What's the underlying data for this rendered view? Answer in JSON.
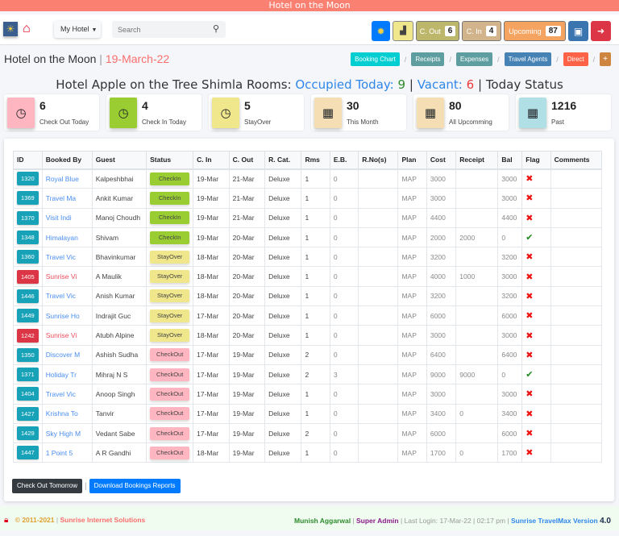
{
  "topbar": {
    "title": "Hotel on the Moon"
  },
  "navbar": {
    "logo_icon": "sun-logo-icon",
    "home_icon": "home-icon",
    "hotel_dropdown": "My Hotel",
    "search": {
      "placeholder": "Search",
      "value": ""
    },
    "buttons": {
      "settings_icon": "gear-icon",
      "chart_icon": "chart-icon",
      "checkout_label": "C. Out",
      "checkout_count": "6",
      "checkin_label": "C. In",
      "checkin_count": "4",
      "upcoming_label": "Upcoming",
      "upcoming_count": "87",
      "bus_icon": "bus-icon",
      "logout_icon": "sign-out-icon"
    }
  },
  "subheader": {
    "hotel_name": "Hotel on the Moon",
    "separator": "|",
    "date": "19-March-22",
    "breadcrumbs": [
      "Booking Chart",
      "Receipts",
      "Expenses",
      "Travel Agents",
      "Direct"
    ],
    "plus_icon": "plus-square-icon"
  },
  "status_line": {
    "prefix": "Hotel Apple on the Tree Shimla Rooms:",
    "occupied_label": "Occupied Today:",
    "occupied": "9",
    "vacant_label": "Vacant:",
    "vacant": "6",
    "suffix": "Today Status"
  },
  "cards": [
    {
      "value": "6",
      "label": "Check Out Today",
      "icon": "clock-icon",
      "color": "#ffb6c1"
    },
    {
      "value": "4",
      "label": "Check In Today",
      "icon": "clock-icon",
      "color": "#9acd32"
    },
    {
      "value": "5",
      "label": "StayOver",
      "icon": "clock-icon",
      "color": "#f0e68c"
    },
    {
      "value": "30",
      "label": "This Month",
      "icon": "calendar-icon",
      "color": "#f5deb3"
    },
    {
      "value": "80",
      "label": "All Upcomming",
      "icon": "calendar-icon",
      "color": "#f5deb3"
    },
    {
      "value": "1216",
      "label": "Past",
      "icon": "calendar-icon",
      "color": "#b0e0e6"
    }
  ],
  "table": {
    "headers": [
      "ID",
      "Booked By",
      "Guest",
      "Status",
      "C. In",
      "C. Out",
      "R. Cat.",
      "Rms",
      "E.B.",
      "R.No(s)",
      "Plan",
      "Cost",
      "Receipt",
      "Bal",
      "Flag",
      "Comments"
    ],
    "rows": [
      {
        "id": "1320",
        "id_color": "#17a2b8",
        "booked_by": "Royal Blue",
        "booked_red": false,
        "guest": "Kalpeshbhai",
        "status": "CheckIn",
        "cin": "19-Mar",
        "cout": "21-Mar",
        "cat": "Deluxe",
        "rms": "1",
        "eb": "0",
        "rno": "",
        "plan": "MAP",
        "cost": "3000",
        "receipt": "",
        "bal": "3000",
        "flag": "x",
        "comments": ""
      },
      {
        "id": "1369",
        "id_color": "#17a2b8",
        "booked_by": "Travel Ma",
        "booked_red": false,
        "guest": "Ankit Kumar",
        "status": "CheckIn",
        "cin": "19-Mar",
        "cout": "21-Mar",
        "cat": "Deluxe",
        "rms": "1",
        "eb": "0",
        "rno": "",
        "plan": "MAP",
        "cost": "3000",
        "receipt": "",
        "bal": "3000",
        "flag": "x",
        "comments": ""
      },
      {
        "id": "1370",
        "id_color": "#17a2b8",
        "booked_by": "Visit Indi",
        "booked_red": false,
        "guest": "Manoj Choudh",
        "status": "CheckIn",
        "cin": "19-Mar",
        "cout": "21-Mar",
        "cat": "Deluxe",
        "rms": "1",
        "eb": "0",
        "rno": "",
        "plan": "MAP",
        "cost": "4400",
        "receipt": "",
        "bal": "4400",
        "flag": "x",
        "comments": ""
      },
      {
        "id": "1348",
        "id_color": "#17a2b8",
        "booked_by": "Himalayan",
        "booked_red": false,
        "guest": "Shivam",
        "status": "CheckIn",
        "cin": "19-Mar",
        "cout": "20-Mar",
        "cat": "Deluxe",
        "rms": "1",
        "eb": "0",
        "rno": "",
        "plan": "MAP",
        "cost": "2000",
        "receipt": "2000",
        "bal": "0",
        "flag": "ok",
        "comments": ""
      },
      {
        "id": "1360",
        "id_color": "#17a2b8",
        "booked_by": "Travel Vic",
        "booked_red": false,
        "guest": "Bhavinkumar",
        "status": "StayOver",
        "cin": "18-Mar",
        "cout": "20-Mar",
        "cat": "Deluxe",
        "rms": "1",
        "eb": "0",
        "rno": "",
        "plan": "MAP",
        "cost": "3200",
        "receipt": "",
        "bal": "3200",
        "flag": "x",
        "comments": ""
      },
      {
        "id": "1405",
        "id_color": "#dc3545",
        "booked_by": "Sunrise Vi",
        "booked_red": true,
        "guest": "A Maulik",
        "status": "StayOver",
        "cin": "18-Mar",
        "cout": "20-Mar",
        "cat": "Deluxe",
        "rms": "1",
        "eb": "0",
        "rno": "",
        "plan": "MAP",
        "cost": "4000",
        "receipt": "1000",
        "bal": "3000",
        "flag": "x",
        "comments": ""
      },
      {
        "id": "1446",
        "id_color": "#17a2b8",
        "booked_by": "Travel Vic",
        "booked_red": false,
        "guest": "Anish Kumar",
        "status": "StayOver",
        "cin": "18-Mar",
        "cout": "20-Mar",
        "cat": "Deluxe",
        "rms": "1",
        "eb": "0",
        "rno": "",
        "plan": "MAP",
        "cost": "3200",
        "receipt": "",
        "bal": "3200",
        "flag": "x",
        "comments": ""
      },
      {
        "id": "1449",
        "id_color": "#17a2b8",
        "booked_by": "Sunrise Ho",
        "booked_red": false,
        "guest": "Indrajit Guc",
        "status": "StayOver",
        "cin": "17-Mar",
        "cout": "20-Mar",
        "cat": "Deluxe",
        "rms": "1",
        "eb": "0",
        "rno": "",
        "plan": "MAP",
        "cost": "6000",
        "receipt": "",
        "bal": "6000",
        "flag": "x",
        "comments": ""
      },
      {
        "id": "1242",
        "id_color": "#dc3545",
        "booked_by": "Sunrise Vi",
        "booked_red": true,
        "guest": "Atubh Alpine",
        "status": "StayOver",
        "cin": "18-Mar",
        "cout": "20-Mar",
        "cat": "Deluxe",
        "rms": "1",
        "eb": "0",
        "rno": "",
        "plan": "MAP",
        "cost": "3000",
        "receipt": "",
        "bal": "3000",
        "flag": "x",
        "comments": ""
      },
      {
        "id": "1350",
        "id_color": "#17a2b8",
        "booked_by": "Discover M",
        "booked_red": false,
        "guest": "Ashish Sudha",
        "status": "CheckOut",
        "cin": "17-Mar",
        "cout": "19-Mar",
        "cat": "Deluxe",
        "rms": "2",
        "eb": "0",
        "rno": "",
        "plan": "MAP",
        "cost": "6400",
        "receipt": "",
        "bal": "6400",
        "flag": "x",
        "comments": ""
      },
      {
        "id": "1371",
        "id_color": "#17a2b8",
        "booked_by": "Holiday Tr",
        "booked_red": false,
        "guest": "Mihraj N S",
        "status": "CheckOut",
        "cin": "17-Mar",
        "cout": "19-Mar",
        "cat": "Deluxe",
        "rms": "2",
        "eb": "3",
        "rno": "",
        "plan": "MAP",
        "cost": "9000",
        "receipt": "9000",
        "bal": "0",
        "flag": "ok",
        "comments": ""
      },
      {
        "id": "1404",
        "id_color": "#17a2b8",
        "booked_by": "Travel Vic",
        "booked_red": false,
        "guest": "Anoop Singh",
        "status": "CheckOut",
        "cin": "17-Mar",
        "cout": "19-Mar",
        "cat": "Deluxe",
        "rms": "1",
        "eb": "0",
        "rno": "",
        "plan": "MAP",
        "cost": "3000",
        "receipt": "",
        "bal": "3000",
        "flag": "x",
        "comments": ""
      },
      {
        "id": "1427",
        "id_color": "#17a2b8",
        "booked_by": "Krishna To",
        "booked_red": false,
        "guest": "Tanvir",
        "status": "CheckOut",
        "cin": "17-Mar",
        "cout": "19-Mar",
        "cat": "Deluxe",
        "rms": "1",
        "eb": "0",
        "rno": "",
        "plan": "MAP",
        "cost": "3400",
        "receipt": "0",
        "bal": "3400",
        "flag": "x",
        "comments": ""
      },
      {
        "id": "1429",
        "id_color": "#17a2b8",
        "booked_by": "Sky High M",
        "booked_red": false,
        "guest": "Vedant Sabe",
        "status": "CheckOut",
        "cin": "17-Mar",
        "cout": "19-Mar",
        "cat": "Deluxe",
        "rms": "2",
        "eb": "0",
        "rno": "",
        "plan": "MAP",
        "cost": "6000",
        "receipt": "",
        "bal": "6000",
        "flag": "x",
        "comments": ""
      },
      {
        "id": "1447",
        "id_color": "#17a2b8",
        "booked_by": "1 Point 5",
        "booked_red": false,
        "guest": "A R Gandhi",
        "status": "CheckOut",
        "cin": "18-Mar",
        "cout": "19-Mar",
        "cat": "Deluxe",
        "rms": "1",
        "eb": "0",
        "rno": "",
        "plan": "MAP",
        "cost": "1700",
        "receipt": "0",
        "bal": "1700",
        "flag": "x",
        "comments": ""
      }
    ]
  },
  "status_colors": {
    "CheckIn": "#9acd32",
    "StayOver": "#f0e68c",
    "CheckOut": "#ffb6c1"
  },
  "footer_buttons": {
    "checkout_tomorrow": "Check Out Tomorrow",
    "download_reports": "Download Bookings Reports"
  },
  "footer": {
    "lock_icon": "lock-icon",
    "copyright": "© 2011-2021",
    "company": "Sunrise Internet Solutions",
    "user": "Munish Aggarwal",
    "role": "Super Admin",
    "last_login": "Last Login: 17-Mar-22 | 02:17 pm",
    "product": "Sunrise TravelMax Version",
    "version": "4.0"
  }
}
